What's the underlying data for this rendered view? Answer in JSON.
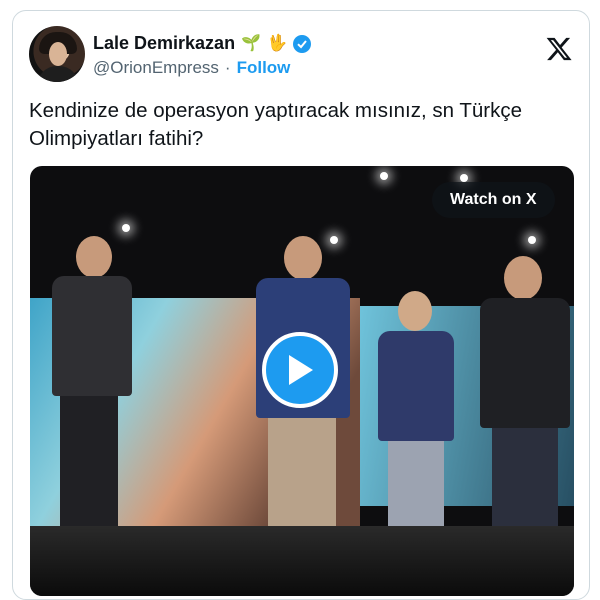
{
  "author": {
    "name": "Lale Demirkazan",
    "emojis": [
      "🌱",
      "🖖"
    ],
    "handle": "@OrionEmpress",
    "separator": "·",
    "follow_label": "Follow"
  },
  "icons": {
    "verified": "verified-badge-icon",
    "x_logo": "x-logo-icon",
    "play": "play-icon"
  },
  "tweet": {
    "text": "Kendinize de operasyon yaptıracak mısınız, sn Türkçe Olimpiyatları fatihi?"
  },
  "media": {
    "watch_label": "Watch on X"
  },
  "colors": {
    "accent": "#1d9bf0",
    "text": "#0f1419",
    "muted": "#536471",
    "border": "#cfd9de"
  }
}
